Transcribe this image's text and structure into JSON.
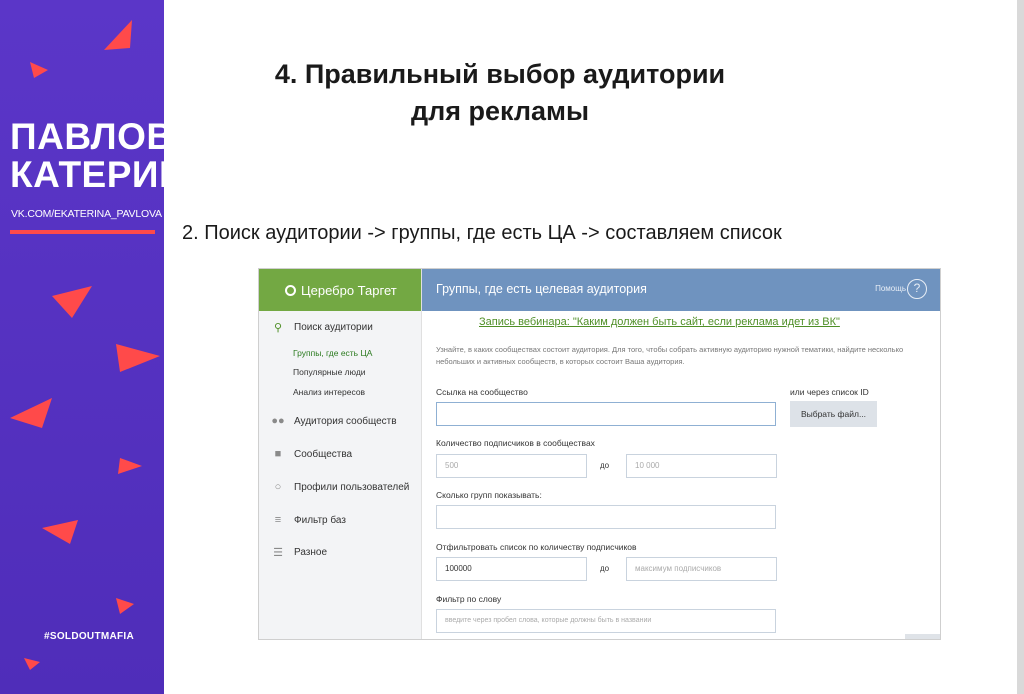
{
  "brand": {
    "name_line1": "ПАВЛОВА",
    "name_line2": "КАТЕРИНА",
    "url": "VK.COM/EKATERINA_PAVLOVA",
    "hashtag": "#SOLDOUTMAFIA",
    "colors": {
      "panel": "#5a34c4",
      "accent": "#ff4a4a"
    }
  },
  "slide": {
    "title_line1": "4. Правильный выбор аудитории",
    "title_line2": "для рекламы",
    "subtitle": "2. Поиск аудитории -> группы, где есть ЦА -> составляем список"
  },
  "app": {
    "logo": "Церебро Таргет",
    "header_title": "Группы, где есть целевая аудитория",
    "help_label": "Помощь",
    "help_icon": "?",
    "sidebar": {
      "search_label": "Поиск аудитории",
      "submenu": [
        "Группы, где есть ЦА",
        "Популярные люди",
        "Анализ интересов"
      ],
      "items": [
        {
          "label": "Аудитория сообществ",
          "icon": "users-icon"
        },
        {
          "label": "Сообщества",
          "icon": "chat-icon"
        },
        {
          "label": "Профили пользователей",
          "icon": "profile-icon"
        },
        {
          "label": "Фильтр баз",
          "icon": "sliders-icon"
        },
        {
          "label": "Разное",
          "icon": "list-icon"
        }
      ]
    },
    "webinar_link": "Запись вебинара: \"Каким должен быть сайт, если реклама идет из ВК\"",
    "description": "Узнайте, в каких сообществах состоит аудитория. Для того, чтобы собрать активную аудиторию нужной тематики, найдите несколько небольших и активных сообществ, в которых состоит Ваша аудитория.",
    "form": {
      "community_link_label": "Ссылка на сообщество",
      "id_list_label": "или через список ID",
      "choose_file": "Выбрать файл...",
      "subscribers_label": "Количество подписчиков в сообществах",
      "subscribers_from_placeholder": "500",
      "subscribers_to_placeholder": "10 000",
      "to_word": "до",
      "groups_count_label": "Сколько групп показывать:",
      "filter_subscribers_label": "Отфильтровать список по количеству подписчиков",
      "filter_from_value": "100000",
      "filter_to_placeholder": "максимум подписчиков",
      "word_filter_label": "Фильтр по слову",
      "word_filter_placeholder": "введите через пробел слова, которые должны быть в названии"
    }
  }
}
